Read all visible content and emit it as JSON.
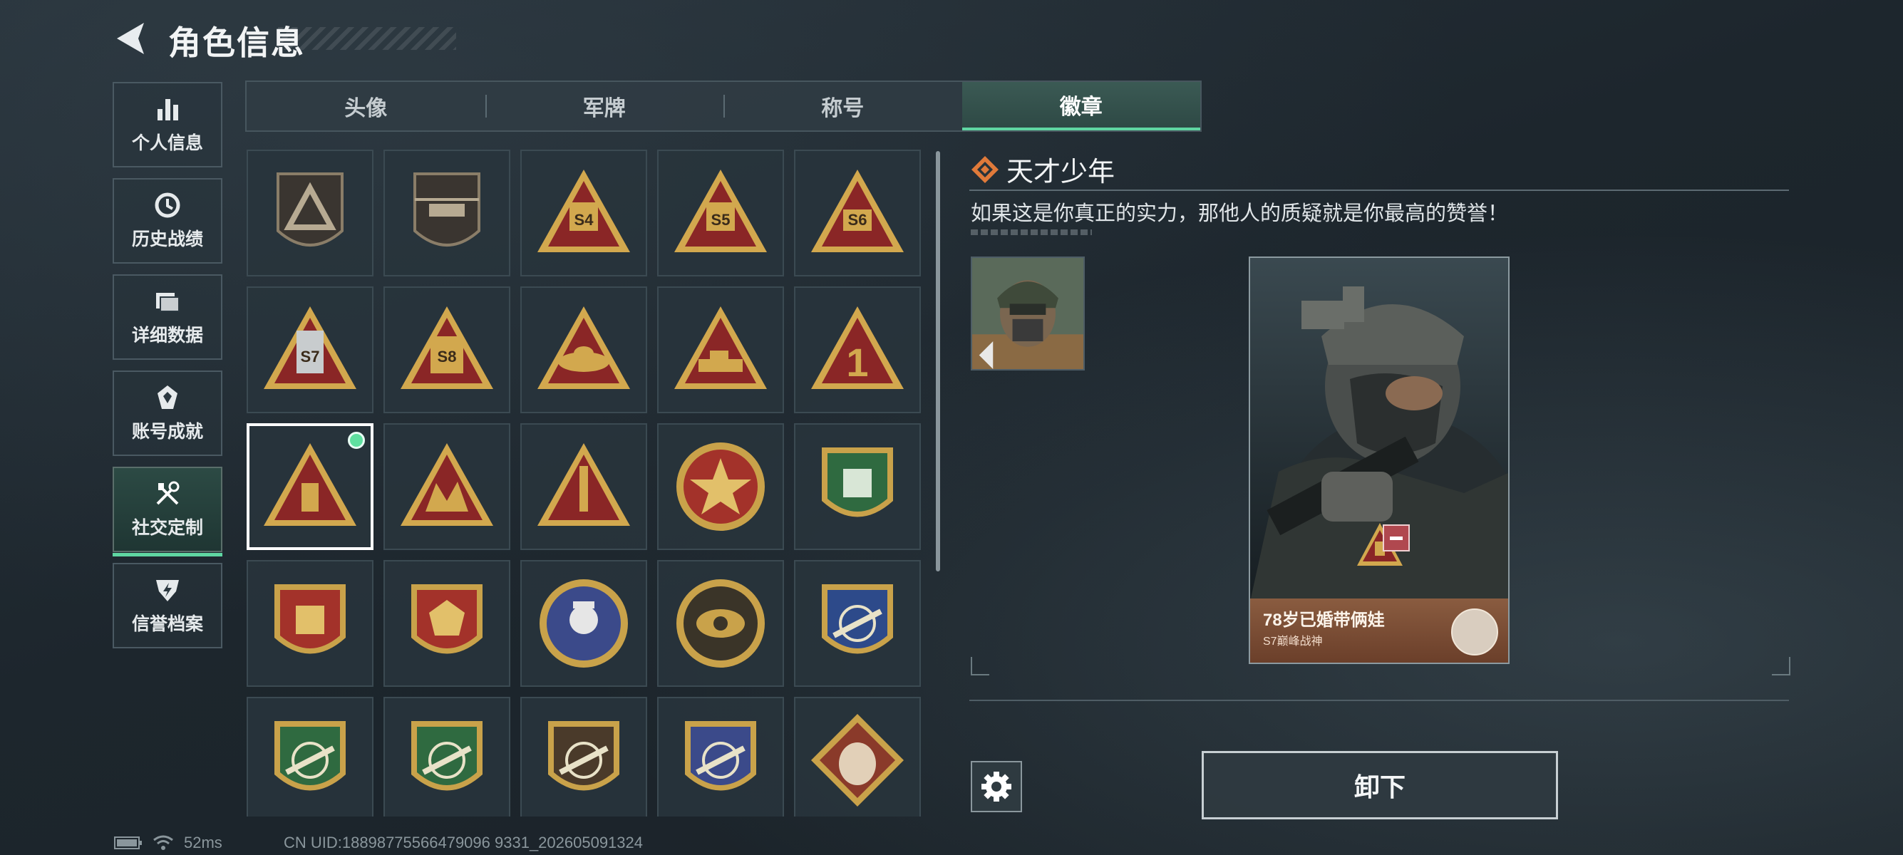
{
  "header": {
    "title": "角色信息",
    "back_icon": "back-arrow-icon"
  },
  "nav": {
    "items": [
      {
        "label": "个人信息",
        "icon": "bar-chart-icon",
        "active": false
      },
      {
        "label": "历史战绩",
        "icon": "history-clock-icon",
        "active": false
      },
      {
        "label": "详细数据",
        "icon": "folder-icon",
        "active": false
      },
      {
        "label": "账号成就",
        "icon": "achievement-icon",
        "active": false
      },
      {
        "label": "社交定制",
        "icon": "tools-icon",
        "active": true
      },
      {
        "label": "信誉档案",
        "icon": "credit-shield-icon",
        "active": false
      }
    ]
  },
  "tabs": [
    {
      "label": "头像",
      "active": false
    },
    {
      "label": "军牌",
      "active": false
    },
    {
      "label": "称号",
      "active": false
    },
    {
      "label": "徽章",
      "active": true
    }
  ],
  "badges": [
    {
      "icon": "triangle-emblem-badge-icon"
    },
    {
      "icon": "helicopter-badge-icon"
    },
    {
      "icon": "s4-badge-icon",
      "text": "S4"
    },
    {
      "icon": "s5-badge-icon",
      "text": "S5"
    },
    {
      "icon": "s6-badge-icon",
      "text": "S6"
    },
    {
      "icon": "s7-badge-icon",
      "text": "S7"
    },
    {
      "icon": "s8-badge-icon",
      "text": "S8"
    },
    {
      "icon": "bird-nest-badge-icon"
    },
    {
      "icon": "tank-badge-icon"
    },
    {
      "icon": "number-one-badge-icon",
      "text": "1"
    },
    {
      "icon": "genius-youth-badge-icon",
      "selected": true,
      "equipped": true
    },
    {
      "icon": "soldiers-badge-icon"
    },
    {
      "icon": "rocket-badge-icon"
    },
    {
      "icon": "skull-star-badge-icon"
    },
    {
      "icon": "green-shield-badge-icon"
    },
    {
      "icon": "gold-laurel-badge-icon"
    },
    {
      "icon": "red-laurel-badge-icon"
    },
    {
      "icon": "ghost-agent-badge-icon"
    },
    {
      "icon": "raven-eye-badge-icon"
    },
    {
      "icon": "rifle-crosshair-blue-badge-icon"
    },
    {
      "icon": "rifle-crosshair-green-badge-icon"
    },
    {
      "icon": "rifle-crosshair-green-2-badge-icon"
    },
    {
      "icon": "rifle-crosshair-brown-badge-icon"
    },
    {
      "icon": "rifle-crosshair-gold-badge-icon"
    },
    {
      "icon": "wolf-badge-icon"
    }
  ],
  "detail": {
    "name": "天才少年",
    "description": "如果这是你真正的实力，那他人的质疑就是你最高的赞誉！",
    "card": {
      "player_name": "78岁已婚带俩娃",
      "subtitle": "S7巅峰战神"
    },
    "unequip_label": "卸下"
  },
  "status": {
    "ping": "52ms",
    "uid": "CN UID:18898775566479096 9331_202605091324"
  },
  "colors": {
    "accent": "#5fd6a2",
    "badge_red": "#8a2626",
    "badge_gold": "#d2a84e",
    "card_footer": "#7a4c34"
  }
}
